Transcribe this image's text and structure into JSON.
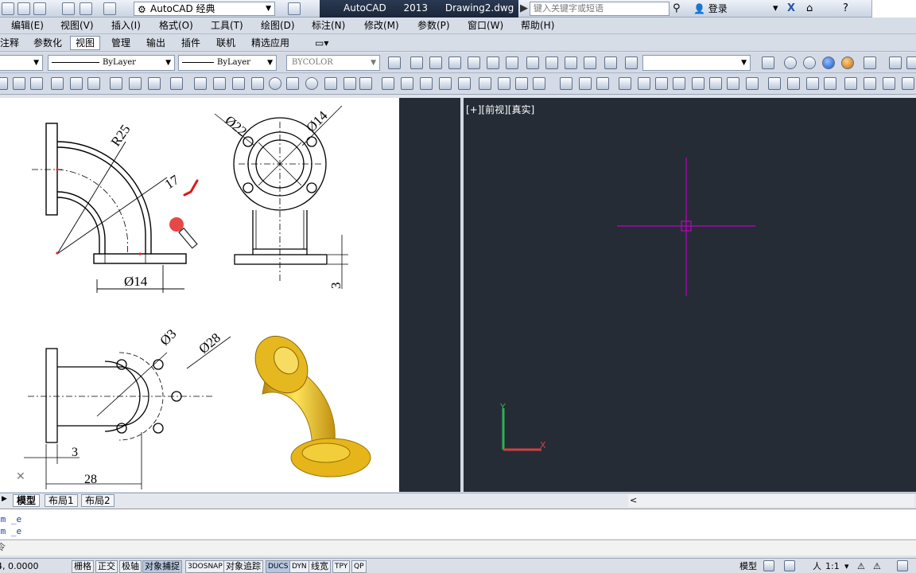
{
  "title_bar": {
    "workspace": "AutoCAD 经典",
    "app_title": "AutoCAD 2013",
    "document": "Drawing2.dwg",
    "search_placeholder": "键入关键字或短语",
    "login_label": "登录"
  },
  "menu_bar": {
    "items": [
      "编辑(E)",
      "视图(V)",
      "插入(I)",
      "格式(O)",
      "工具(T)",
      "绘图(D)",
      "标注(N)",
      "修改(M)",
      "参数(P)",
      "窗口(W)",
      "帮助(H)"
    ]
  },
  "menu_bar_2": {
    "items": [
      "注释",
      "参数化",
      "视图",
      "管理",
      "输出",
      "插件",
      "联机",
      "精选应用"
    ],
    "active": "视图"
  },
  "layer_toolbar": {
    "linetype": "ByLayer",
    "lineweight": "ByLayer",
    "plotstyle": "BYCOLOR"
  },
  "drawing": {
    "dims": {
      "r25": "R25",
      "d22": "Ø22",
      "d14_top": "Ø14",
      "d17": "17",
      "d14_bottom": "Ø14",
      "dim3_right": "3",
      "d3": "Ø3",
      "d28": "Ø28",
      "dim3_bottom": "3",
      "dim28": "28"
    }
  },
  "viewport": {
    "label": "[+][前视][真实]"
  },
  "tabs": {
    "items": [
      "模型",
      "布局1",
      "布局2"
    ],
    "active": "模型"
  },
  "command": {
    "lines": [
      "om _e",
      "om _e"
    ],
    "prompt": "令"
  },
  "status_bar": {
    "coords": "4, 0.0000",
    "buttons": [
      "栅格",
      "正交",
      "极轴",
      "对象捕捉",
      "3DOSNAP",
      "对象追踪",
      "DUCS",
      "DYN",
      "线宽",
      "TPY",
      "QP"
    ],
    "active": [
      "对象捕捉",
      "DUCS"
    ],
    "model_label": "模型",
    "scale": "1:1"
  },
  "colors": {
    "viewport_bg": "#252c36",
    "crosshair": "#c000c0",
    "ucs_x": "#d04040",
    "ucs_y": "#30b050",
    "pipe_gold": "#e8b818"
  }
}
